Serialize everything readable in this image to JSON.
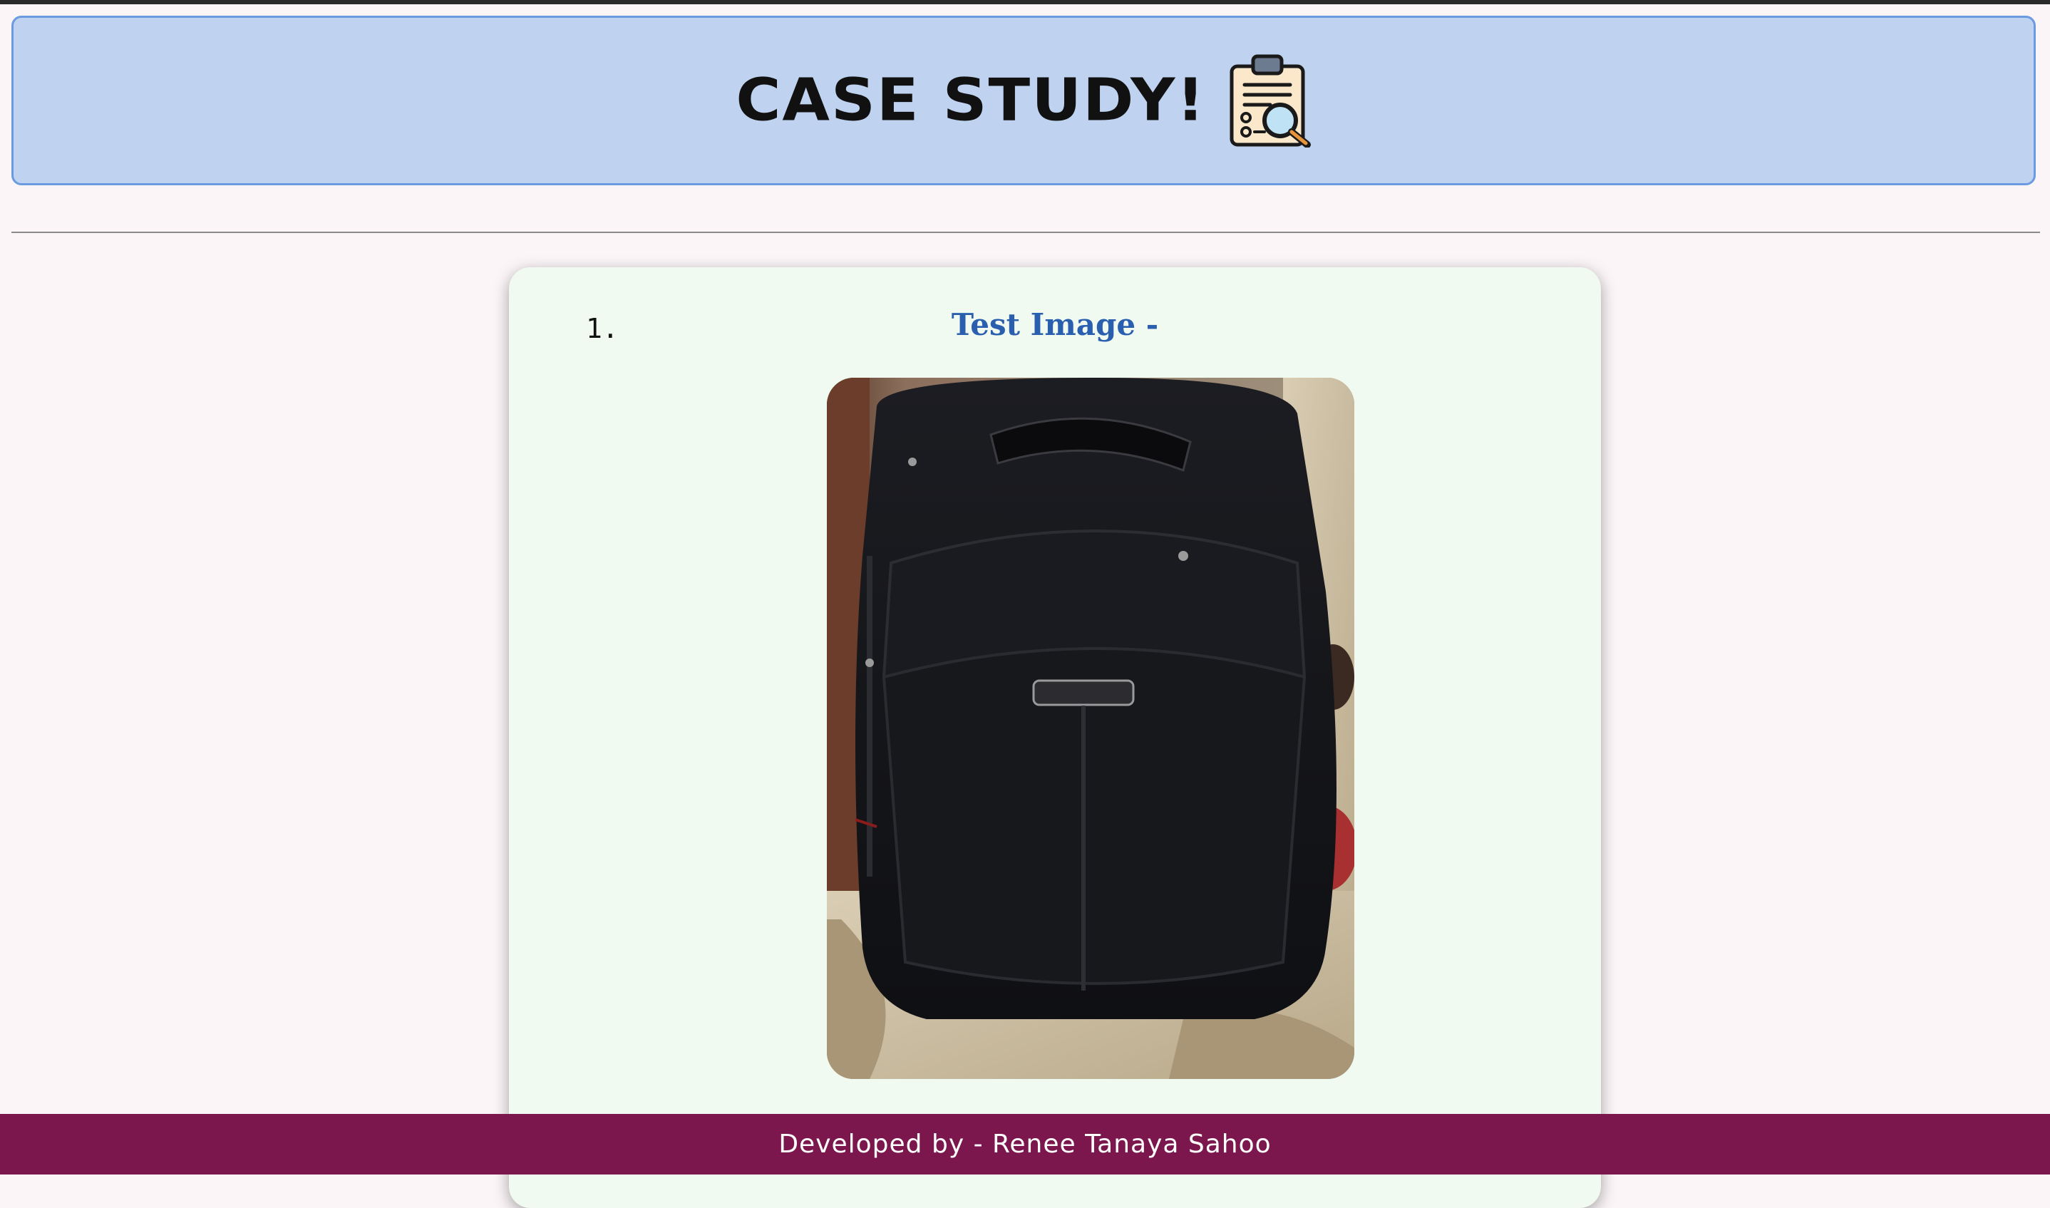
{
  "header": {
    "title": "CASE STUDY!",
    "icon": "clipboard-magnifier-icon",
    "background": "#bfd2f0",
    "border_color": "#6a9be0"
  },
  "case_item": {
    "number": "1.",
    "title": "Test Image -",
    "image": "black-backpack-photo"
  },
  "footer": {
    "text": "Developed by - Renee Tanaya Sahoo",
    "background": "#7c174e"
  },
  "colors": {
    "page_background": "#fbf5f7",
    "card_background": "#f1faf0",
    "item_title": "#2a5fb0"
  }
}
